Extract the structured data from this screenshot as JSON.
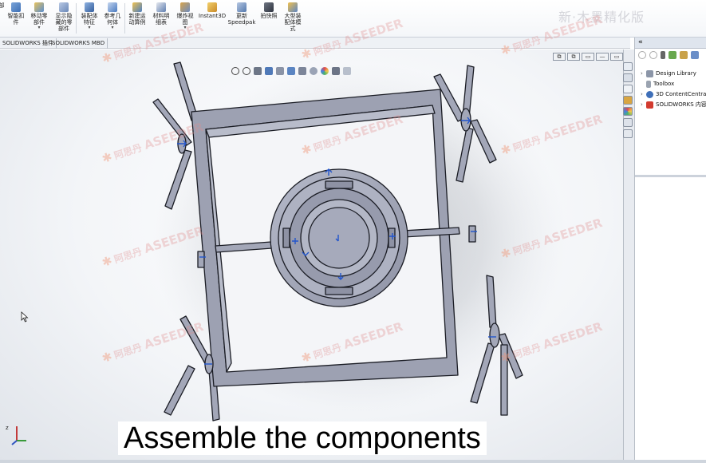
{
  "ribbon": {
    "buttons": [
      {
        "label": "智能扣\n件",
        "icon": "smart-fastener-icon"
      },
      {
        "label": "移动零\n部件",
        "icon": "move-component-icon",
        "dropdown": true
      },
      {
        "label": "显示隐\n藏的零\n部件",
        "icon": "show-hidden-icon"
      },
      {
        "label": "装配体\n特征",
        "icon": "assembly-feature-icon",
        "dropdown": true
      },
      {
        "label": "参考几\n何体",
        "icon": "reference-geometry-icon",
        "dropdown": true
      },
      {
        "label": "新建运\n动算例",
        "icon": "motion-study-icon"
      },
      {
        "label": "材料明\n细表",
        "icon": "bom-icon"
      },
      {
        "label": "爆炸视\n图",
        "icon": "exploded-view-icon",
        "dropdown": true
      },
      {
        "label": "Instant3D",
        "icon": "instant3d-icon"
      },
      {
        "label": "更新\nSpeedpak",
        "icon": "speedpak-icon"
      },
      {
        "label": "拍快照",
        "icon": "snapshot-icon"
      },
      {
        "label": "大型装\n配体模\n式",
        "icon": "large-assembly-icon"
      }
    ]
  },
  "tabs": [
    "SOLIDWORKS 插件",
    "SOLIDWORKS MBD"
  ],
  "window_buttons": [
    "⧉",
    "⧉",
    "▭",
    "—",
    "▭",
    "✕"
  ],
  "task_pane": {
    "collapse_label": "«",
    "items": [
      {
        "label": "Design Library",
        "icon": "design-library-icon"
      },
      {
        "label": "Toolbox",
        "icon": "toolbox-icon"
      },
      {
        "label": "3D ContentCentral",
        "icon": "content-central-icon"
      },
      {
        "label": "SOLIDWORKS 内容",
        "icon": "solidworks-content-icon"
      }
    ]
  },
  "watermark": {
    "brand": "ASEEDER",
    "cn": "阿思丹"
  },
  "top_logo": "新·木墨精化版",
  "subtitle": "Assemble the components",
  "colors": {
    "part": "#a3a7b8",
    "part_edge": "#1a1c24",
    "accent_blue": "#2255cc"
  }
}
